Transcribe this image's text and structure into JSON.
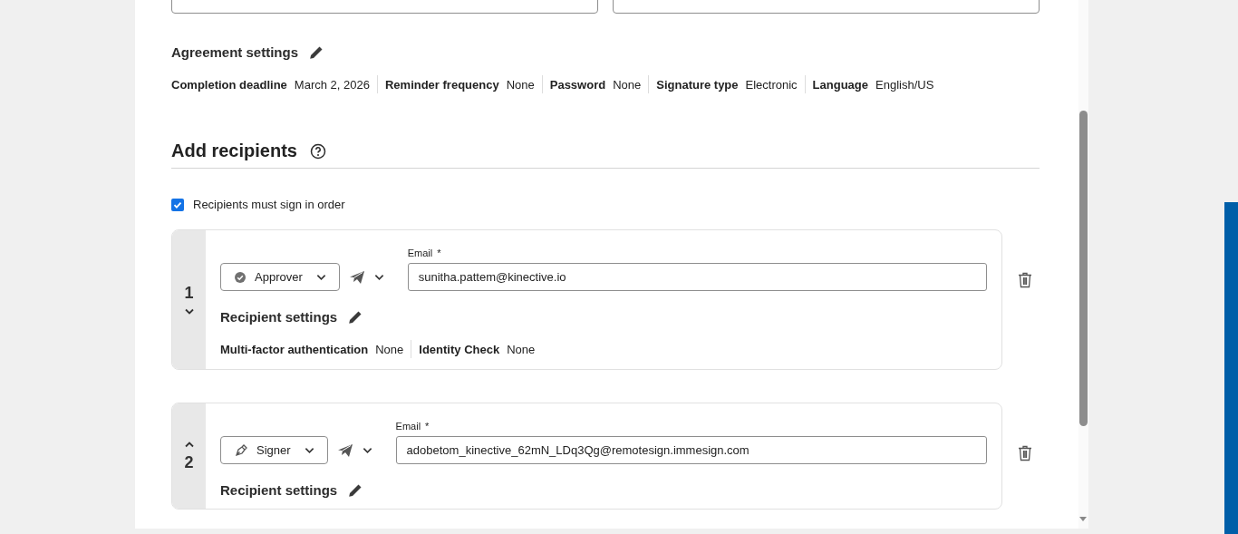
{
  "agreement_settings": {
    "title": "Agreement settings",
    "items": [
      {
        "label": "Completion deadline",
        "value": "March 2, 2026"
      },
      {
        "label": "Reminder frequency",
        "value": "None"
      },
      {
        "label": "Password",
        "value": "None"
      },
      {
        "label": "Signature type",
        "value": "Electronic"
      },
      {
        "label": "Language",
        "value": "English/US"
      }
    ]
  },
  "add_recipients": {
    "title": "Add recipients",
    "sign_in_order": {
      "label": "Recipients must sign in order",
      "checked": true
    },
    "recipients": [
      {
        "number": "1",
        "can_move_up": false,
        "can_move_down": true,
        "role": {
          "kind": "approver",
          "label": "Approver"
        },
        "email_label": "Email",
        "required_mark": "*",
        "email": "sunitha.pattem@kinective.io",
        "settings_title": "Recipient settings",
        "settings": [
          {
            "label": "Multi-factor authentication",
            "value": "None"
          },
          {
            "label": "Identity Check",
            "value": "None"
          }
        ]
      },
      {
        "number": "2",
        "can_move_up": true,
        "can_move_down": false,
        "role": {
          "kind": "signer",
          "label": "Signer"
        },
        "email_label": "Email",
        "required_mark": "*",
        "email": "adobetom_kinective_62mN_LDq3Qg@remotesign.immesign.com",
        "settings_title": "Recipient settings"
      }
    ]
  }
}
